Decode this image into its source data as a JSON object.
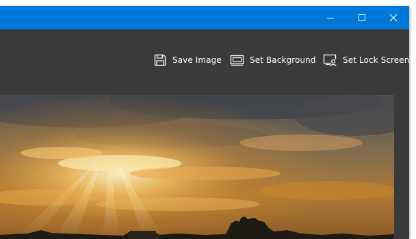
{
  "window": {
    "title_bar_color": "#0078d7",
    "controls": {
      "minimize_icon": "minimize-icon",
      "maximize_icon": "maximize-icon",
      "close_icon": "close-icon"
    }
  },
  "toolbar": {
    "background_color": "#3a3a3a",
    "buttons": [
      {
        "label": "Save Image",
        "icon": "save-icon"
      },
      {
        "label": "Set Background",
        "icon": "desktop-background-icon"
      },
      {
        "label": "Set Lock Screen",
        "icon": "lock-screen-icon"
      }
    ]
  },
  "image": {
    "subject": "sunset-clouds-over-temple-ruins"
  }
}
